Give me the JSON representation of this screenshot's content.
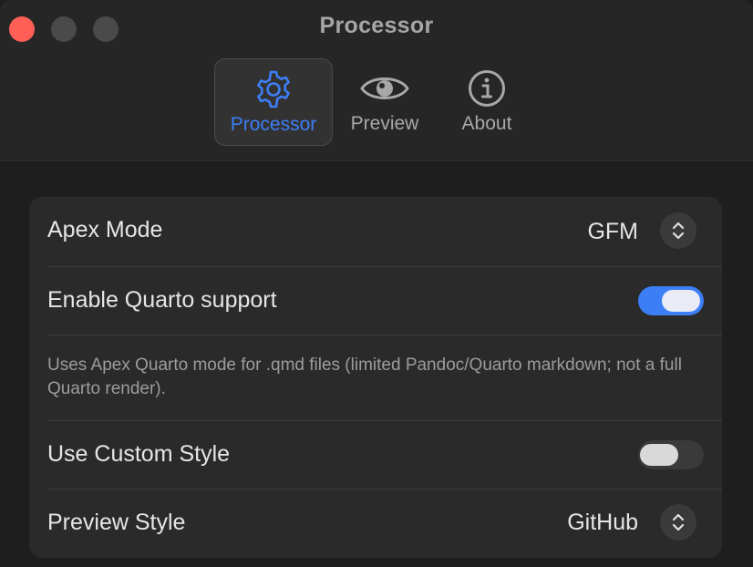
{
  "window": {
    "title": "Processor"
  },
  "tabs": [
    {
      "label": "Processor",
      "icon": "gear-icon",
      "active": true
    },
    {
      "label": "Preview",
      "icon": "eye-icon",
      "active": false
    },
    {
      "label": "About",
      "icon": "info-icon",
      "active": false
    }
  ],
  "settings": {
    "apex_mode": {
      "label": "Apex Mode",
      "value": "GFM"
    },
    "quarto": {
      "label": "Enable Quarto support",
      "enabled": true,
      "description": "Uses Apex Quarto mode for .qmd files (limited Pandoc/Quarto markdown; not a full Quarto render)."
    },
    "custom_style": {
      "label": "Use Custom Style",
      "enabled": false
    },
    "preview_style": {
      "label": "Preview Style",
      "value": "GitHub"
    }
  },
  "colors": {
    "accent": "#3d7ef6",
    "close_button": "#ff5f57",
    "background": "#1e1e1e",
    "group_background": "#2a2a2a"
  }
}
